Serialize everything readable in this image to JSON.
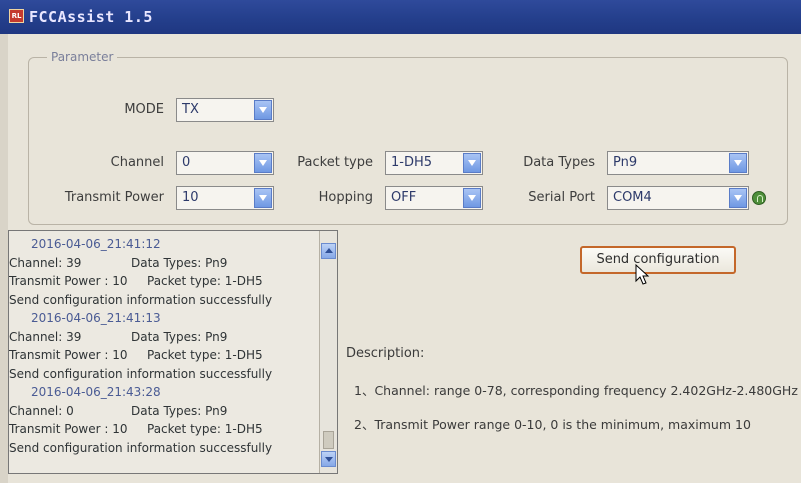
{
  "window": {
    "title": "FCCAssist 1.5",
    "icon_text": "RL"
  },
  "parameter": {
    "legend": "Parameter",
    "mode": {
      "label": "MODE",
      "value": "TX"
    },
    "channel": {
      "label": "Channel",
      "value": "0"
    },
    "packet_type": {
      "label": "Packet type",
      "value": "1-DH5"
    },
    "data_types": {
      "label": "Data Types",
      "value": "Pn9"
    },
    "transmit_power": {
      "label": "Transmit Power",
      "value": "10"
    },
    "hopping": {
      "label": "Hopping",
      "value": "OFF"
    },
    "serial_port": {
      "label": "Serial Port",
      "value": "COM4"
    }
  },
  "log": {
    "lines": [
      {
        "kind": "ts",
        "a": "2016-04-06_21:41:12",
        "b": ""
      },
      {
        "kind": "row",
        "a": "Channel: 39",
        "b": "Data Types: Pn9"
      },
      {
        "kind": "row",
        "a": "Transmit Power : 10",
        "b": "Packet type: 1-DH5"
      },
      {
        "kind": "msg",
        "a": "Send configuration information successfully",
        "b": ""
      },
      {
        "kind": "ts",
        "a": "2016-04-06_21:41:13",
        "b": ""
      },
      {
        "kind": "row",
        "a": "Channel: 39",
        "b": "Data Types: Pn9"
      },
      {
        "kind": "row",
        "a": "Transmit Power : 10",
        "b": "Packet type: 1-DH5"
      },
      {
        "kind": "msg",
        "a": "Send configuration information successfully",
        "b": ""
      },
      {
        "kind": "ts",
        "a": "2016-04-06_21:43:28",
        "b": ""
      },
      {
        "kind": "row",
        "a": "Channel: 0",
        "b": "Data Types: Pn9"
      },
      {
        "kind": "row",
        "a": "Transmit Power : 10",
        "b": "Packet type: 1-DH5"
      },
      {
        "kind": "msg",
        "a": "Send configuration information successfully",
        "b": ""
      }
    ]
  },
  "send_button": {
    "label": "Send configuration"
  },
  "description": {
    "title": "Description:",
    "items": [
      "1、Channel: range 0-78, corresponding frequency 2.402GHz-2.480GHz",
      "2、Transmit Power  range 0-10, 0 is the minimum, maximum 10"
    ]
  },
  "colors": {
    "titlebar": "#243f8c",
    "button_border": "#c4672a",
    "combo_arrow": "#6f98e3",
    "connected_icon": "#4e8f3a"
  }
}
